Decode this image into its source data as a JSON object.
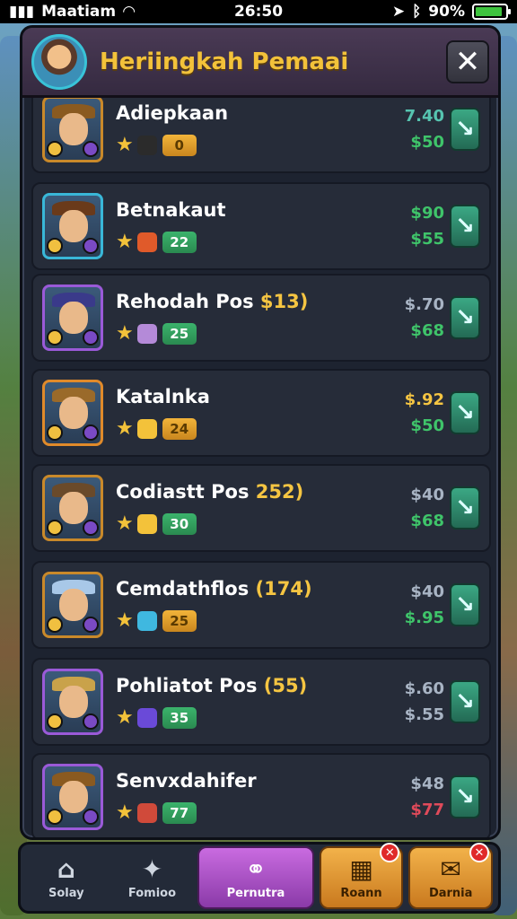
{
  "status_bar": {
    "carrier": "Maatiam",
    "time": "26:50",
    "battery": "90%"
  },
  "panel": {
    "title": "Heriingkah Pemaai",
    "close_label": "✕"
  },
  "items": [
    {
      "name": "Adiepkaan",
      "name_suffix": "",
      "price_top": "7.40",
      "price_bottom": "$50",
      "level": "0",
      "level_style": "gold",
      "top_color": "teal",
      "bottom_color": "green",
      "frame": "#c9892a",
      "hat": "#8a5a20",
      "gem1": "#f3c23a",
      "gem2": "#2b2b2b",
      "stars": "★"
    },
    {
      "name": "Betnakaut",
      "name_suffix": "",
      "price_top": "$90",
      "price_bottom": "$55",
      "level": "22",
      "level_style": "green",
      "top_color": "green",
      "bottom_color": "green",
      "frame": "#39b7d8",
      "hat": "#6a3a1a",
      "gem1": "#f3c23a",
      "gem2": "#e05a2a",
      "stars": ""
    },
    {
      "name": "Rehodah Pos ",
      "name_suffix": "$13)",
      "price_top": "$.70",
      "price_bottom": "$68",
      "level": "25",
      "level_style": "green",
      "top_color": "gray",
      "bottom_color": "green",
      "frame": "#9a5ad8",
      "hat": "#3a3a8a",
      "gem1": "#f3c23a",
      "gem2": "#b48ad8",
      "stars": "★"
    },
    {
      "name": "Katalnka",
      "name_suffix": "",
      "price_top": "$.92",
      "price_bottom": "$50",
      "level": "24",
      "level_style": "gold",
      "top_color": "yellow",
      "bottom_color": "green",
      "frame": "#e08a2a",
      "hat": "#9a6a2a",
      "gem1": "#f3c23a",
      "gem2": "#f3c23a",
      "stars": "★"
    },
    {
      "name": "Codiastt Pos ",
      "name_suffix": "252)",
      "price_top": "$40",
      "price_bottom": "$68",
      "level": "30",
      "level_style": "green",
      "top_color": "gray",
      "bottom_color": "green",
      "frame": "#c9892a",
      "hat": "#6a4a2a",
      "gem1": "#f3c23a",
      "gem2": "#f3c23a",
      "stars": "★"
    },
    {
      "name": "Cemdathflos ",
      "name_suffix": "(174)",
      "price_top": "$40",
      "price_bottom": "$.95",
      "level": "25",
      "level_style": "gold",
      "top_color": "gray",
      "bottom_color": "green",
      "frame": "#c9892a",
      "hat": "#a8c8e8",
      "gem1": "#f3c23a",
      "gem2": "#3fb8e0",
      "stars": ""
    },
    {
      "name": "Pohliatot Pos ",
      "name_suffix": "(55)",
      "price_top": "$.60",
      "price_bottom": "$.55",
      "level": "35",
      "level_style": "green",
      "top_color": "gray",
      "bottom_color": "gray",
      "frame": "#9a5ad8",
      "hat": "#c9a24a",
      "gem1": "#f3c23a",
      "gem2": "#6a4ad8",
      "stars": ""
    },
    {
      "name": "Senvxdahifer",
      "name_suffix": "",
      "price_top": "$48",
      "price_bottom": "$77",
      "level": "77",
      "level_style": "green",
      "top_color": "gray",
      "bottom_color": "red",
      "frame": "#9a5ad8",
      "hat": "#8a5a20",
      "gem1": "#f3c23a",
      "gem2": "#d04a3a",
      "stars": ""
    }
  ],
  "nav": [
    {
      "label": "Solay",
      "icon": "⌂",
      "style": "plain"
    },
    {
      "label": "Fomioo",
      "icon": "✦",
      "style": "plain"
    },
    {
      "label": "Pernutra",
      "icon": "⚭",
      "style": "active"
    },
    {
      "label": "Roann",
      "icon": "▦",
      "style": "gold",
      "badge": "✕"
    },
    {
      "label": "Darnia",
      "icon": "✉",
      "style": "gold",
      "badge": "✕"
    }
  ]
}
